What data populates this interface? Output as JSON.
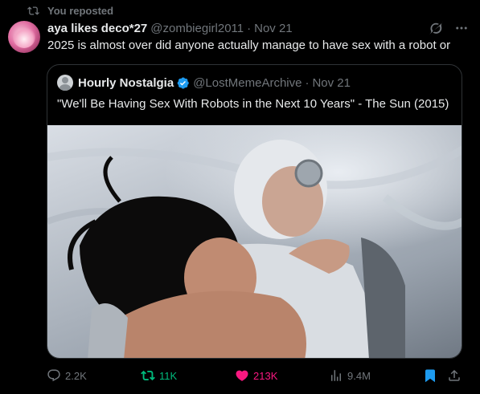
{
  "repost": {
    "label": "You reposted"
  },
  "tweet": {
    "display_name": "aya likes deco*27",
    "handle": "@zombiegirl2011",
    "separator": "·",
    "date": "Nov 21",
    "text": "2025 is almost over did anyone actually manage to have sex with a robot or"
  },
  "quote": {
    "display_name": "Hourly Nostalgia",
    "handle": "@LostMemeArchive",
    "separator": "·",
    "date": "Nov 21",
    "text": "\"We'll Be Having Sex With Robots in the Next 10 Years\" - The Sun (2015)"
  },
  "actions": {
    "replies": "2.2K",
    "retweets": "11K",
    "likes": "213K",
    "views": "9.4M"
  },
  "colors": {
    "background": "#000000",
    "text": "#e7e9ea",
    "muted": "#71767b",
    "border": "#2f3336",
    "retweet_green": "#00ba7c",
    "like_pink": "#f91880",
    "bookmark_blue": "#1d9bf0",
    "verified_blue": "#1d9bf0"
  },
  "icons": [
    "retweet-icon",
    "grok-icon",
    "more-icon",
    "verified-icon",
    "reply-icon",
    "like-icon",
    "views-icon",
    "bookmark-icon",
    "share-icon"
  ]
}
